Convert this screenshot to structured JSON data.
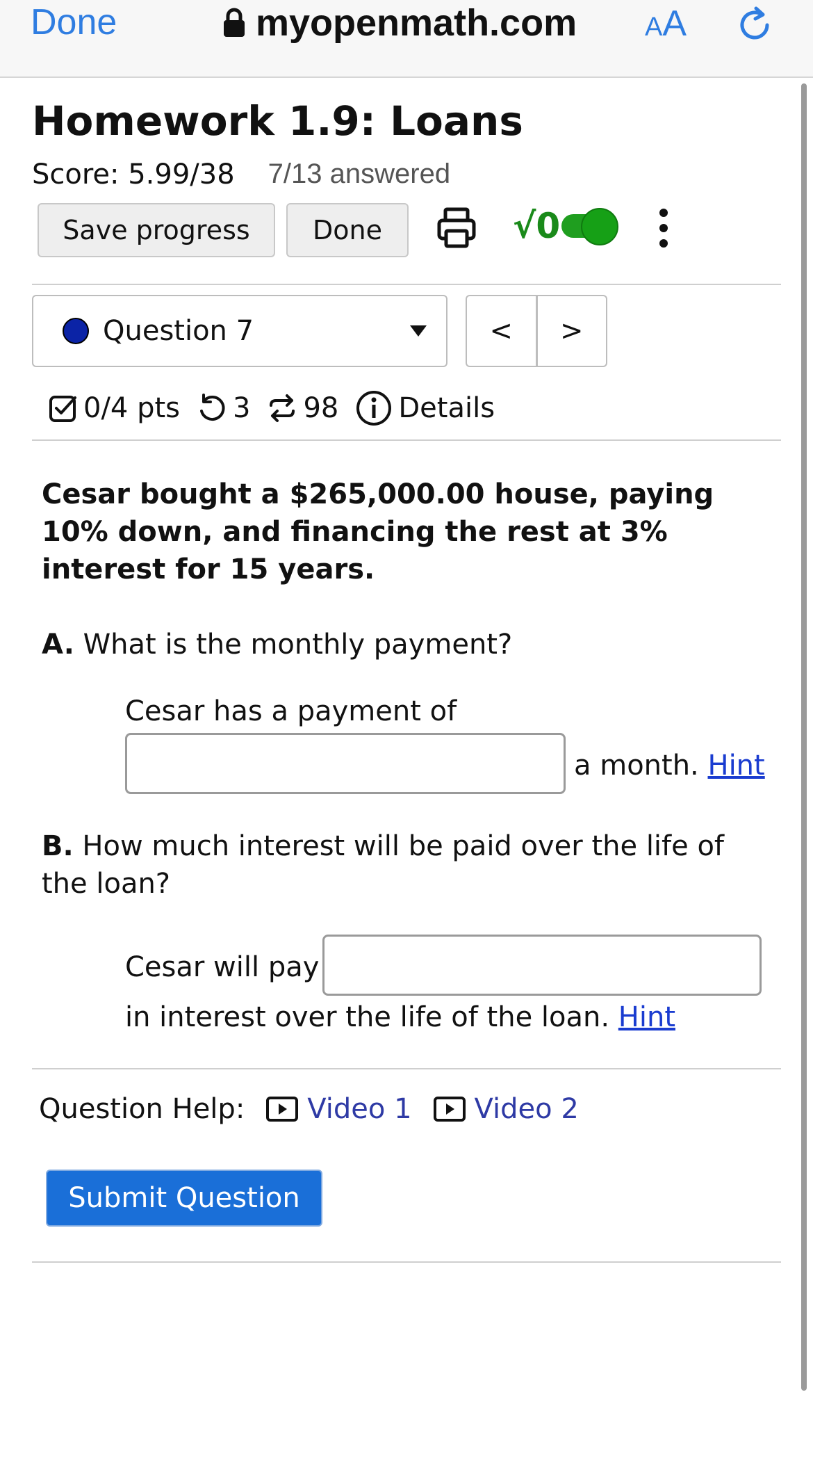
{
  "browser": {
    "done_label": "Done",
    "url": "myopenmath.com",
    "text_size_label_small": "A",
    "text_size_label_large": "A"
  },
  "header": {
    "title": "Homework 1.9: Loans",
    "score": "Score: 5.99/38",
    "answered": "7/13 answered"
  },
  "toolbar": {
    "save_label": "Save progress",
    "done_label": "Done",
    "math_toggle_label": "√0",
    "math_toggle_on": true
  },
  "question_nav": {
    "selected": "Question 7",
    "status_color": "#0b23a6",
    "prev_label": "<",
    "next_label": ">"
  },
  "question_meta": {
    "points": "0/4 pts",
    "retries": "3",
    "versions": "98",
    "details_label": "Details"
  },
  "problem": {
    "statement": "Cesar bought a $265,000.00 house, paying 10% down, and financing the rest at 3% interest for 15 years.",
    "part_a": {
      "letter": "A.",
      "question": "What is the monthly payment?",
      "prompt_before": "Cesar has a payment of",
      "prompt_after": "a month.",
      "input_value": "",
      "hint_label": "Hint"
    },
    "part_b": {
      "letter": "B.",
      "question": "How much interest will be paid over the life of the loan?",
      "prompt_before": "Cesar will pay",
      "prompt_after": "in interest over the life of the loan.",
      "input_value": "",
      "hint_label": "Hint"
    }
  },
  "help": {
    "label": "Question Help:",
    "video1": "Video 1",
    "video2": "Video 2"
  },
  "submit_label": "Submit Question",
  "colors": {
    "accent": "#2f7de1",
    "submit": "#1a6fd8",
    "toggle_on": "#1f9e1f",
    "link": "#1a3cd0"
  }
}
